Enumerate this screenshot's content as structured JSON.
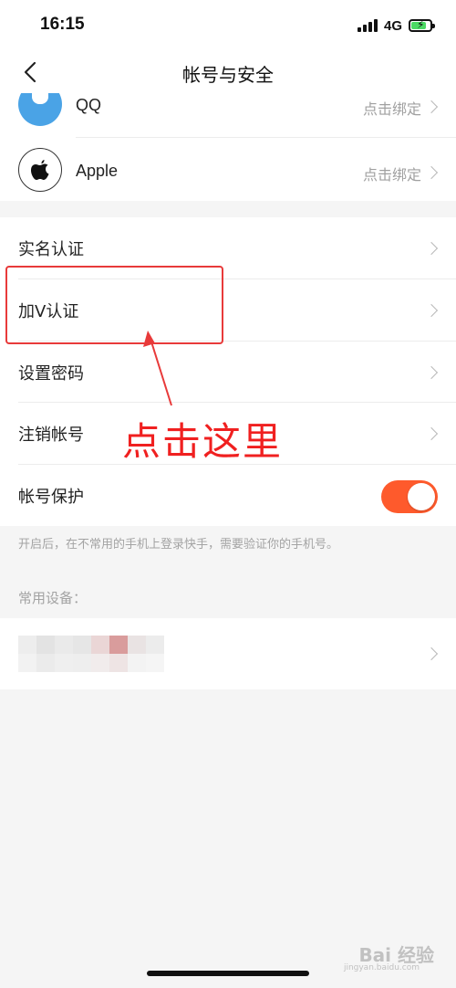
{
  "status_bar": {
    "time": "16:15",
    "network": "4G"
  },
  "nav": {
    "title": "帐号与安全"
  },
  "accounts": [
    {
      "label": "QQ",
      "action": "点击绑定",
      "icon": "qq-icon"
    },
    {
      "label": "Apple",
      "action": "点击绑定",
      "icon": "apple-icon"
    }
  ],
  "menu": [
    {
      "label": "实名认证"
    },
    {
      "label": "加V认证"
    },
    {
      "label": "设置密码"
    },
    {
      "label": "注销帐号"
    },
    {
      "label": "帐号保护",
      "toggle": true
    }
  ],
  "hint": "开启后，在不常用的手机上登录快手，需要验证你的手机号。",
  "devices_title": "常用设备：",
  "annotation": {
    "text": "点击这里",
    "color": "#f02020"
  },
  "watermark": {
    "text": "Bai 经验",
    "sub": "jingyan.baidu.com"
  },
  "colors": {
    "accent": "#fe5a2c",
    "annotation": "#e83a3a"
  }
}
